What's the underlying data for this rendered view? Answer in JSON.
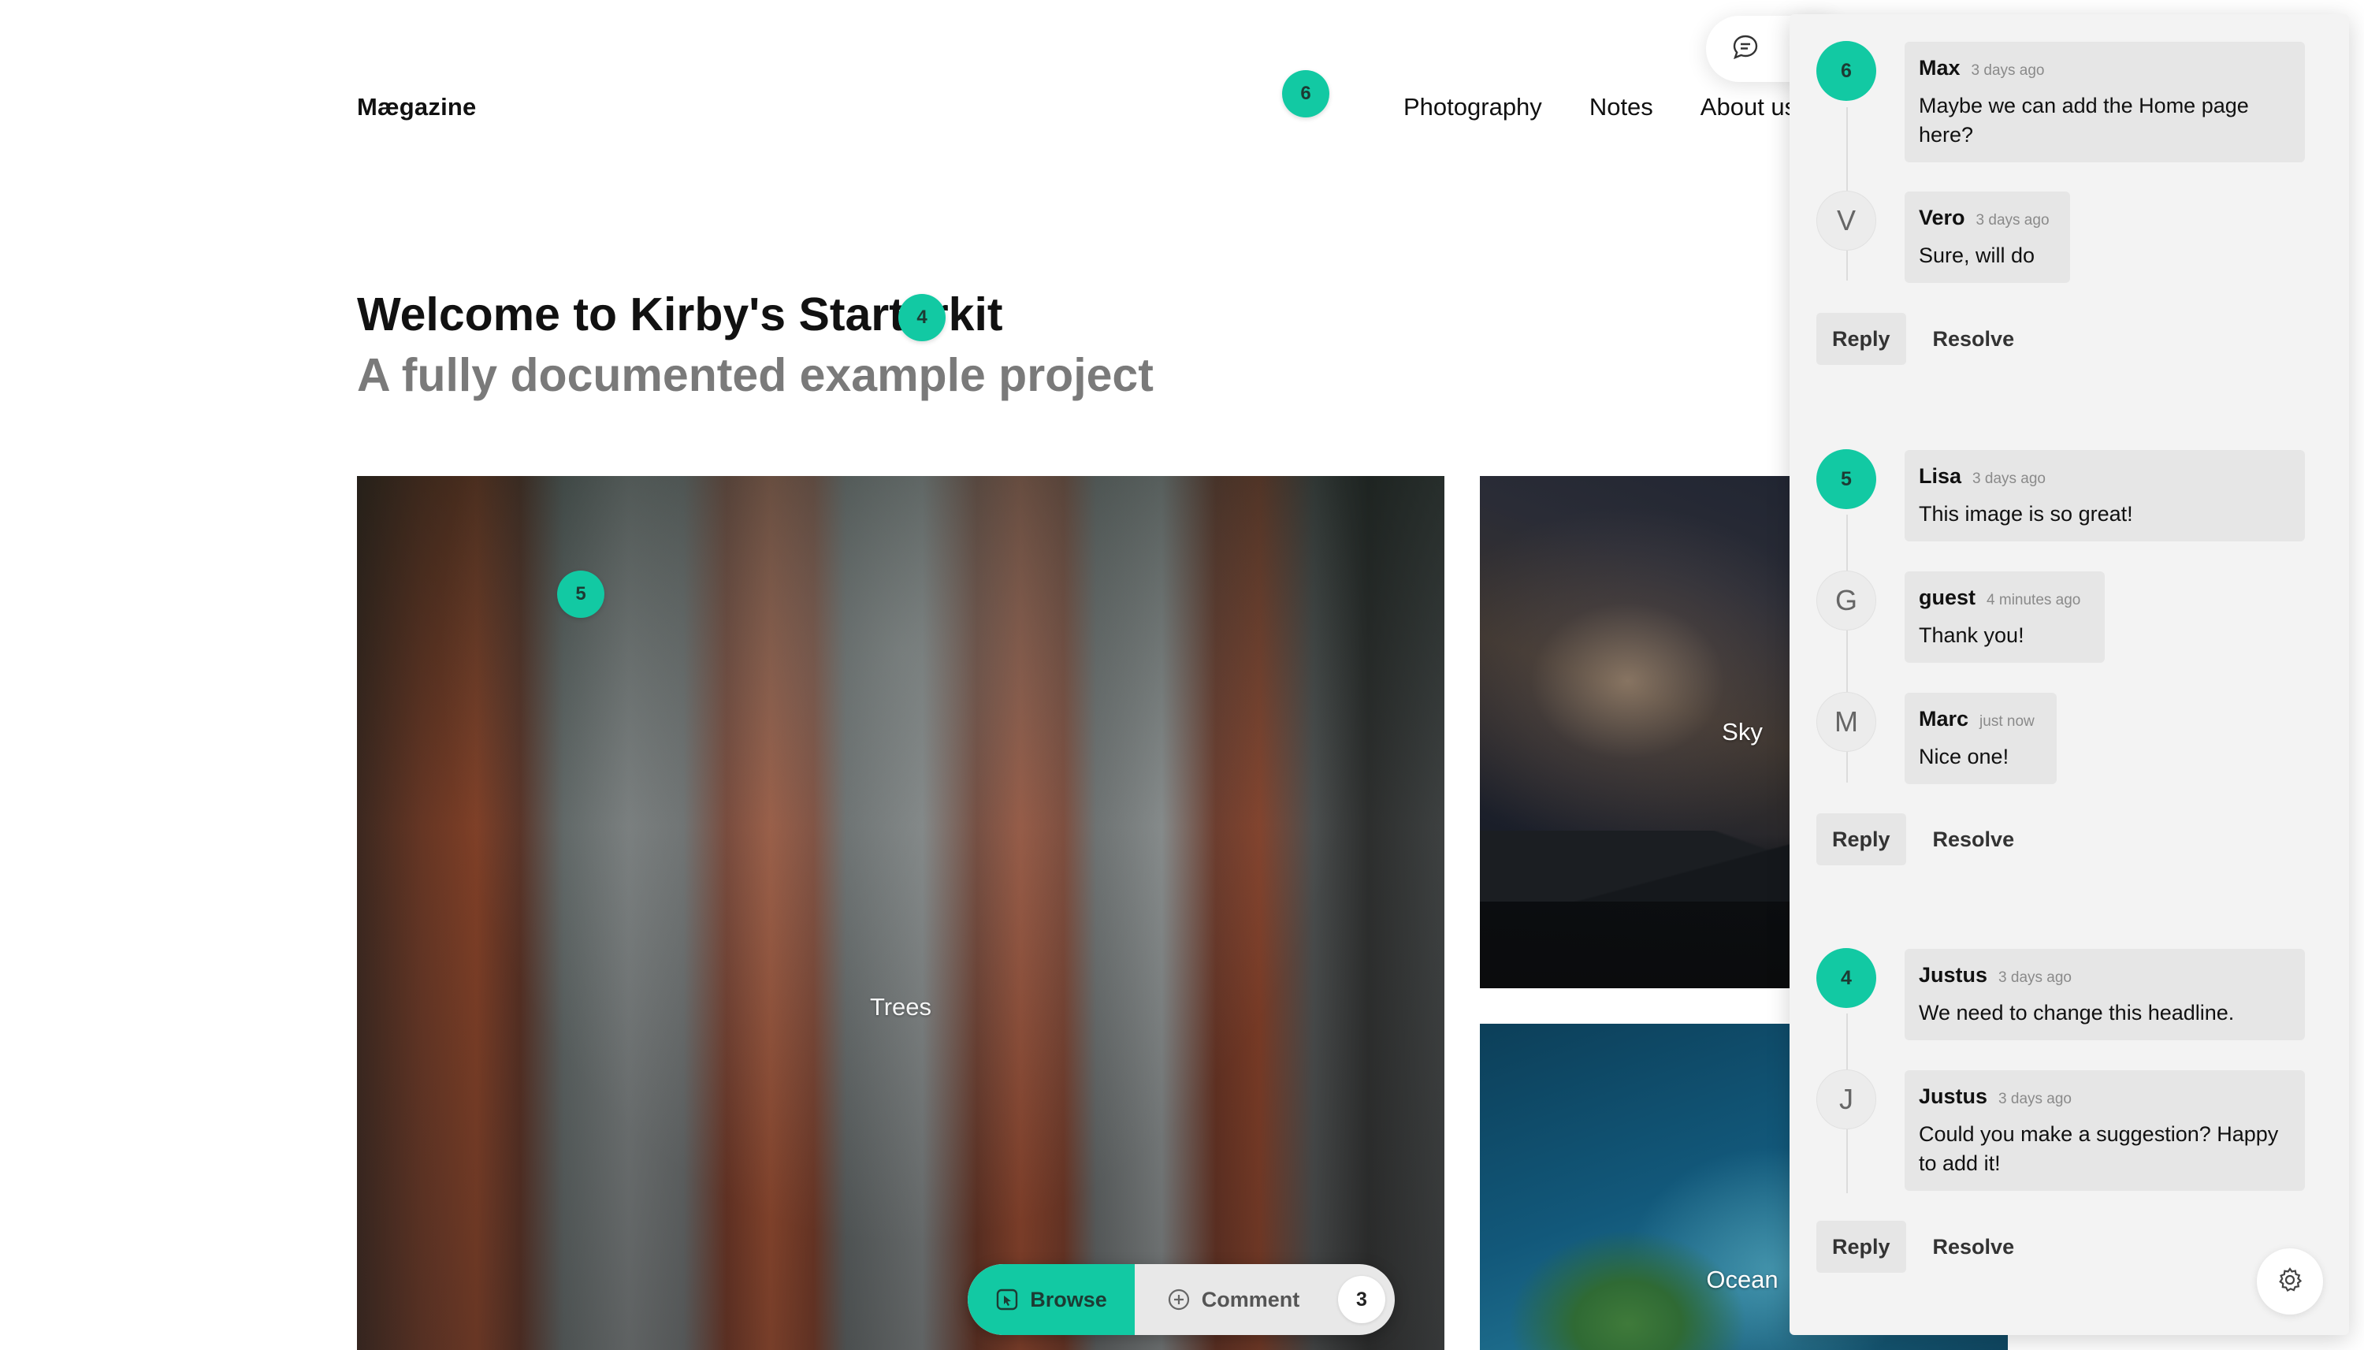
{
  "site": {
    "logo": "Mægazine",
    "nav": [
      "Photography",
      "Notes",
      "About us"
    ]
  },
  "hero": {
    "title": "Welcome to Kirby's Starterkit",
    "subtitle": "A fully documented example project"
  },
  "gallery": {
    "trees_caption": "Trees",
    "sky_caption": "Sky",
    "ocean_caption": "Ocean"
  },
  "pins": {
    "nav_pin": "6",
    "title_pin": "4",
    "image_pin": "5"
  },
  "toolbar": {
    "browse_label": "Browse",
    "comment_label": "Comment",
    "count": "3"
  },
  "threads": [
    {
      "comments": [
        {
          "avatar": "6",
          "author": "Max",
          "time": "3 days ago",
          "text": "Maybe we can add the Home page here?"
        },
        {
          "avatar": "V",
          "author": "Vero",
          "time": "3 days ago",
          "text": "Sure, will do"
        }
      ],
      "reply_label": "Reply",
      "resolve_label": "Resolve"
    },
    {
      "comments": [
        {
          "avatar": "5",
          "author": "Lisa",
          "time": "3 days ago",
          "text": "This image is so great!"
        },
        {
          "avatar": "G",
          "author": "guest",
          "time": "4 minutes ago",
          "text": "Thank you!"
        },
        {
          "avatar": "M",
          "author": "Marc",
          "time": "just now",
          "text": "Nice one!"
        }
      ],
      "reply_label": "Reply",
      "resolve_label": "Resolve"
    },
    {
      "comments": [
        {
          "avatar": "4",
          "author": "Justus",
          "time": "3 days ago",
          "text": "We need to change this headline."
        },
        {
          "avatar": "J",
          "author": "Justus",
          "time": "3 days ago",
          "text": "Could you make a suggestion? Happy to add it!"
        }
      ],
      "reply_label": "Reply",
      "resolve_label": "Resolve"
    }
  ],
  "colors": {
    "accent": "#12c9a3",
    "panel_bg": "#f3f3f3",
    "bubble_bg": "#e6e6e6"
  },
  "icons": {
    "comment_toggle": "speech-bubble-icon",
    "browse": "cursor-icon",
    "comment": "plus-circle-icon",
    "settings": "gear-icon"
  }
}
